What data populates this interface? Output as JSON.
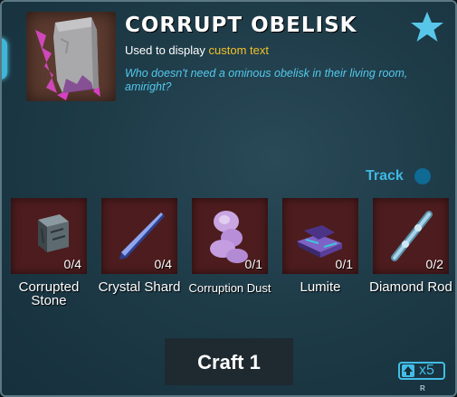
{
  "item": {
    "title": "CORRUPT OBELISK",
    "subtitle_prefix": "Used to display",
    "subtitle_accent": "custom text",
    "description": "Who doesn't need a ominous obelisk in their living room, amiright?",
    "icon": "corrupt-obelisk-icon"
  },
  "actions": {
    "track_label": "Track",
    "craft_label": "Craft 1",
    "multiplier_label": "x5",
    "multiplier_hotkey": "R",
    "favorite_icon": "star-icon"
  },
  "ingredients": [
    {
      "name": "Corrupted Stone",
      "count": "0/4",
      "icon": "corrupted-stone-icon"
    },
    {
      "name": "Crystal Shard",
      "count": "0/4",
      "icon": "crystal-shard-icon"
    },
    {
      "name": "Corruption Dust",
      "count": "0/1",
      "icon": "corruption-dust-icon"
    },
    {
      "name": "Lumite",
      "count": "0/1",
      "icon": "lumite-icon"
    },
    {
      "name": "Diamond Rod",
      "count": "0/2",
      "icon": "diamond-rod-icon"
    }
  ],
  "colors": {
    "accent_blue": "#42bde6",
    "highlight_yellow": "#f3c12a",
    "slot_background": "#4d1c1e"
  }
}
